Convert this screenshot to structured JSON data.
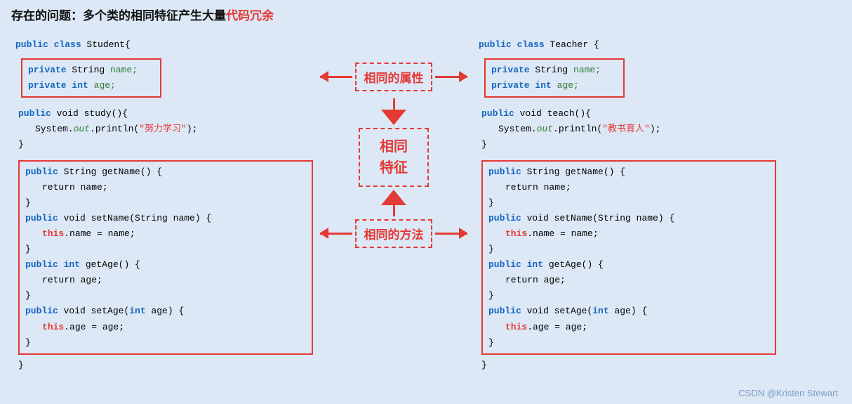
{
  "title": {
    "prefix": "存在的问题：多个类的相同特征产生大量",
    "highlight": "代码冗余"
  },
  "student": {
    "class_decl": "public class Student{",
    "field1_kw": "private",
    "field1_type": " String ",
    "field1_name": "name;",
    "field2_kw": "private",
    "field2_type": " int ",
    "field2_name": "age;",
    "method1_kw": "public",
    "method1_rest": " void study(){",
    "method1_body1": "    System.",
    "method1_italic": "out",
    "method1_body2": ".println(",
    "method1_str": "\"努力学习\"",
    "method1_body3": ");",
    "method1_close": "}",
    "method1_close2": "}",
    "getname_kw": "public",
    "getname_rest": " String getName() {",
    "getname_body": "    return name;",
    "getname_close": "}",
    "setname_kw": "public",
    "setname_rest": " void setName(String name) {",
    "setname_body1": "    this",
    "setname_body1b": ".name = name;",
    "setname_close": "}",
    "getage_kw": "public",
    "getage_rest": " int getAge() {",
    "getage_body": "    return age;",
    "getage_close": "}",
    "setage_kw": "public",
    "setage_rest": " void setAge(int age) {",
    "setage_body1": "    this",
    "setage_body1b": ".age = age;",
    "setage_close": "}",
    "class_close": "}"
  },
  "teacher": {
    "class_decl": "public class Teacher {",
    "field1_kw": "private",
    "field1_type": " String ",
    "field1_name": "name;",
    "field2_kw": "private",
    "field2_type": " int ",
    "field2_name": "age;",
    "method1_kw": "public",
    "method1_rest": " void teach(){",
    "method1_body1": "    System.",
    "method1_italic": "out",
    "method1_body2": ".println(",
    "method1_str": "\"教书育人\"",
    "method1_body3": ");",
    "method1_close": "}",
    "method1_close2": "}",
    "getname_kw": "public",
    "getname_rest": " String getName() {",
    "getname_body": "    return name;",
    "getname_close": "}",
    "setname_kw": "public",
    "setname_rest": " void setName(String name) {",
    "setname_body1": "    this",
    "setname_body1b": ".name = name;",
    "setname_close": "}",
    "getage_kw": "public",
    "getage_rest": " int getAge() {",
    "getage_body": "    return age;",
    "getage_close": "}",
    "setage_kw": "public",
    "setage_rest": " void setAge(int age) {",
    "setage_body1": "    this",
    "setage_body1b": ".age = age;",
    "setage_close": "}",
    "class_close": "}"
  },
  "center": {
    "label_attrs": "相同的属性",
    "label_methods": "相同\n特征",
    "label_methods2": "相同的方法"
  },
  "watermark": "CSDN @Kristen  Stewart"
}
